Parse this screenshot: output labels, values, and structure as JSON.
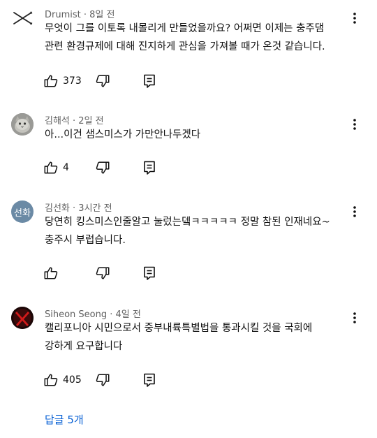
{
  "comments": [
    {
      "author": "Drumist",
      "time": "8일 전",
      "text": "무엇이 그를 이토록 내몰리게 만들었을까요? 어쩌면 이제는 충주댐\n관련 환경규제에 대해 진지하게 관심을 가져볼 때가 온것 같습니다.",
      "likes": "373",
      "avatar_icon": "drumsticks-avatar-icon"
    },
    {
      "author": "김해석",
      "time": "2일 전",
      "text": "아...이건 샘스미스가 가만안나두겠다",
      "likes": "4",
      "avatar_icon": "cat-photo-avatar-icon"
    },
    {
      "author": "김선화",
      "time": "3시간 전",
      "text": "당연히 킹스미스인줄알고 눌렀는뎈ㅋㅋㅋㅋㅋ 정말 참된 인재네요~\n충주시 부럽습니다.",
      "likes": "",
      "avatar_initials": "선화",
      "avatar_color": "#6b8aa5"
    },
    {
      "author": "Siheon Seong",
      "time": "4일 전",
      "text": "캘리포니아 시민으로서 중부내륙특별법을 통과시킬 것을 국회에\n강하게 요구합니다",
      "likes": "405",
      "avatar_icon": "red-x-avatar-icon"
    }
  ],
  "replies_link": "답글 5개",
  "colors": {
    "link": "#065fd4",
    "meta": "#606060",
    "text": "#0f0f0f"
  }
}
